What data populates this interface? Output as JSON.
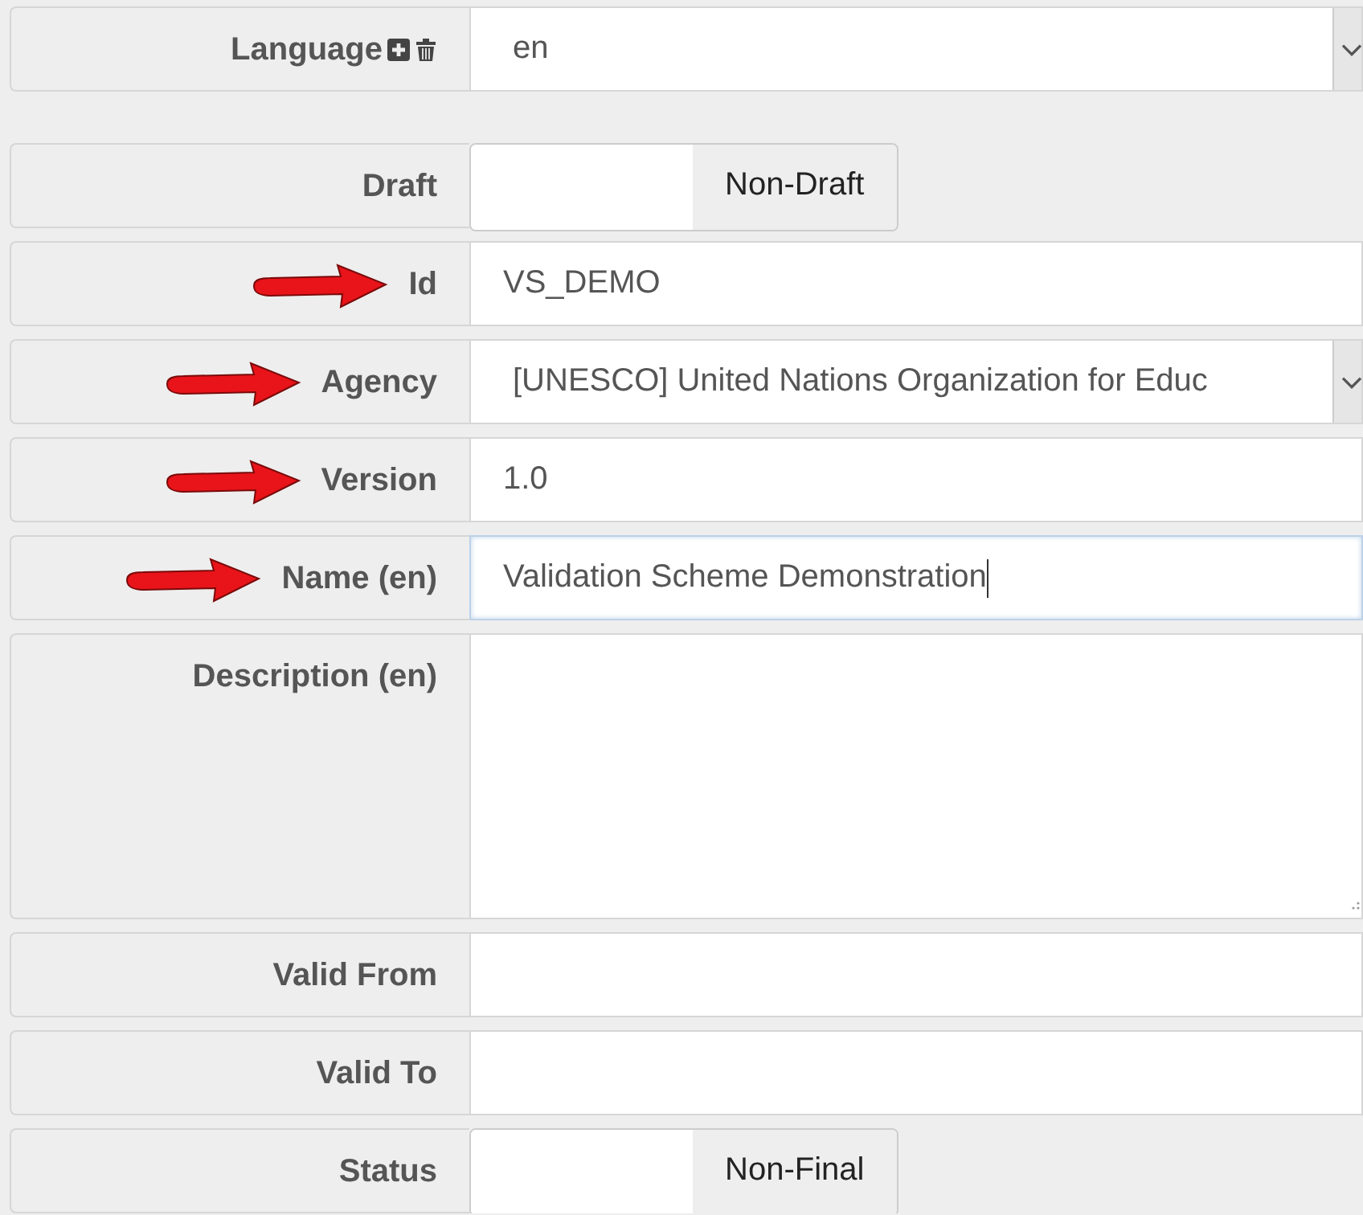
{
  "rows": [
    {
      "kind": "select",
      "label": "Language",
      "icons": true,
      "value": "en",
      "arrow": false,
      "focused": false
    },
    {
      "kind": "toggle",
      "label": "Draft",
      "toggle_label": "Non-Draft",
      "on": false,
      "arrow": false
    },
    {
      "kind": "text",
      "label": "Id",
      "value": "VS_DEMO",
      "arrow": true,
      "focused": false
    },
    {
      "kind": "select",
      "label": "Agency",
      "value": "[UNESCO] United Nations Organization for Educ",
      "arrow": true,
      "focused": false
    },
    {
      "kind": "text",
      "label": "Version",
      "value": "1.0",
      "arrow": true,
      "focused": false
    },
    {
      "kind": "text",
      "label": "Name (en)",
      "value": "Validation Scheme Demonstration",
      "arrow": true,
      "focused": true
    },
    {
      "kind": "textarea",
      "label": "Description (en)",
      "arrow": false,
      "focused": false
    },
    {
      "kind": "text",
      "label": "Valid From",
      "arrow": false,
      "focused": false
    },
    {
      "kind": "text",
      "label": "Valid To",
      "arrow": false,
      "focused": false
    },
    {
      "kind": "toggle",
      "label": "Status",
      "toggle_label": "Non-Final",
      "on": false,
      "arrow": false
    }
  ]
}
